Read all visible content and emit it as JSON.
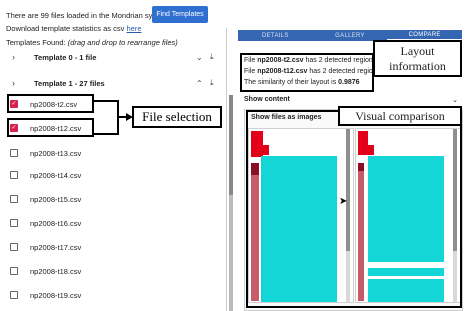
{
  "header": {
    "status_text": "There are 99 files loaded in the Mondrian system",
    "find_button": "Find Templates",
    "download_prefix": "Download template statistics as csv",
    "download_link": "here",
    "templates_found": "Templates Found:",
    "templates_hint": "(drag and drop to rearrange files)"
  },
  "templates": [
    {
      "label": "Template 0 - 1 file",
      "expanded": false
    },
    {
      "label": "Template 1 - 27 files",
      "expanded": true
    }
  ],
  "files": [
    {
      "name": "np2008-t2.csv",
      "checked": true
    },
    {
      "name": "np2008-t12.csv",
      "checked": true
    },
    {
      "name": "np2008-t13.csv",
      "checked": false
    },
    {
      "name": "np2008-t14.csv",
      "checked": false
    },
    {
      "name": "np2008-t15.csv",
      "checked": false
    },
    {
      "name": "np2008-t16.csv",
      "checked": false
    },
    {
      "name": "np2008-t17.csv",
      "checked": false
    },
    {
      "name": "np2008-t18.csv",
      "checked": false
    },
    {
      "name": "np2008-t19.csv",
      "checked": false
    }
  ],
  "annotations": {
    "file_selection": "File selection",
    "layout_information_line1": "Layout",
    "layout_information_line2": "information",
    "visual_comparison": "Visual comparison"
  },
  "tabs": [
    {
      "label": "DETAILS",
      "active": false
    },
    {
      "label": "GALLERY",
      "active": false
    },
    {
      "label": "COMPARE",
      "active": true
    }
  ],
  "compare": {
    "line1_prefix": "File ",
    "line1_file": "np2008-t2.csv",
    "line1_suffix": " has 2 detected regions",
    "line2_prefix": "File ",
    "line2_file": "np2008-t12.csv",
    "line2_suffix": " has 2 detected regions",
    "line3_prefix": "The similarity of their layout is ",
    "line3_value": "0.9876",
    "show_content": "Show content",
    "show_as_images": "Show files as images"
  },
  "colors": {
    "accent": "#3466b2",
    "checkbox": "#d6224f",
    "region_cyan": "#14d6d6",
    "region_red": "#e3001b",
    "region_darkred": "#8b0f24",
    "region_mid": "#c85a6a"
  },
  "icons": {
    "collapsed": "chevron-right-icon",
    "expanded": "chevron-down-icon",
    "download": "download-icon",
    "collapse_group": "chevron-up-icon",
    "dropdown": "caret-down-icon",
    "cursor": "mouse-pointer-icon"
  }
}
